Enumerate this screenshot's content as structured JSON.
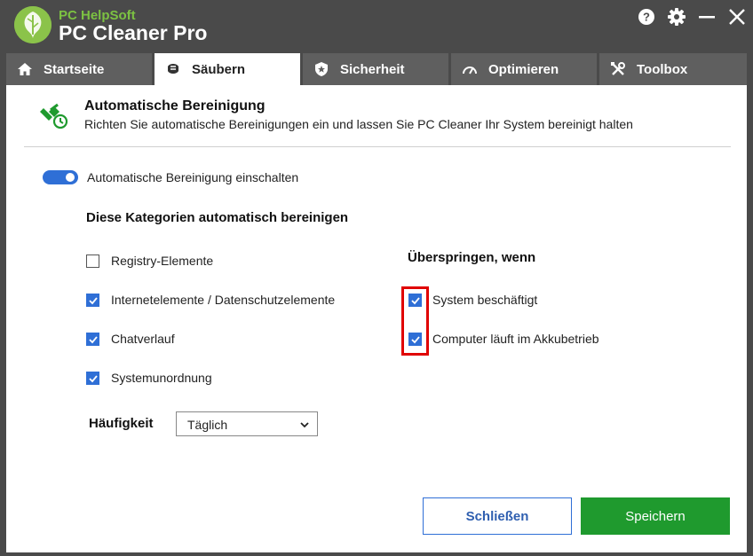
{
  "app": {
    "brand_small": "PC HelpSoft",
    "brand_name": "PC Cleaner Pro"
  },
  "tabs": [
    {
      "label": "Startseite",
      "icon": "home-icon"
    },
    {
      "label": "Säubern",
      "icon": "broom-icon",
      "active": true
    },
    {
      "label": "Sicherheit",
      "icon": "shield-icon"
    },
    {
      "label": "Optimieren",
      "icon": "speedometer-icon"
    },
    {
      "label": "Toolbox",
      "icon": "tools-icon"
    }
  ],
  "header": {
    "title": "Automatische Bereinigung",
    "subtitle": "Richten Sie automatische Bereinigungen ein und lassen Sie PC Cleaner Ihr System bereinigt halten"
  },
  "auto_clean": {
    "toggle_label": "Automatische Bereinigung einschalten",
    "enabled": true
  },
  "categories": {
    "title": "Diese Kategorien automatisch bereinigen",
    "items": [
      {
        "label": "Registry-Elemente",
        "checked": false
      },
      {
        "label": "Internetelemente / Datenschutzelemente",
        "checked": true
      },
      {
        "label": "Chatverlauf",
        "checked": true
      },
      {
        "label": "Systemunordnung",
        "checked": true
      }
    ]
  },
  "skip": {
    "title": "Überspringen, wenn",
    "items": [
      {
        "label": "System beschäftigt",
        "checked": true
      },
      {
        "label": "Computer läuft im Akkubetrieb",
        "checked": true
      }
    ]
  },
  "frequency": {
    "label": "Häufigkeit",
    "selected": "Täglich"
  },
  "buttons": {
    "close": "Schließen",
    "save": "Speichern"
  },
  "colors": {
    "accent": "#2f6fd6",
    "save_green": "#1f9a2e",
    "highlight_red": "#e00000",
    "brand_green": "#7cc242"
  }
}
